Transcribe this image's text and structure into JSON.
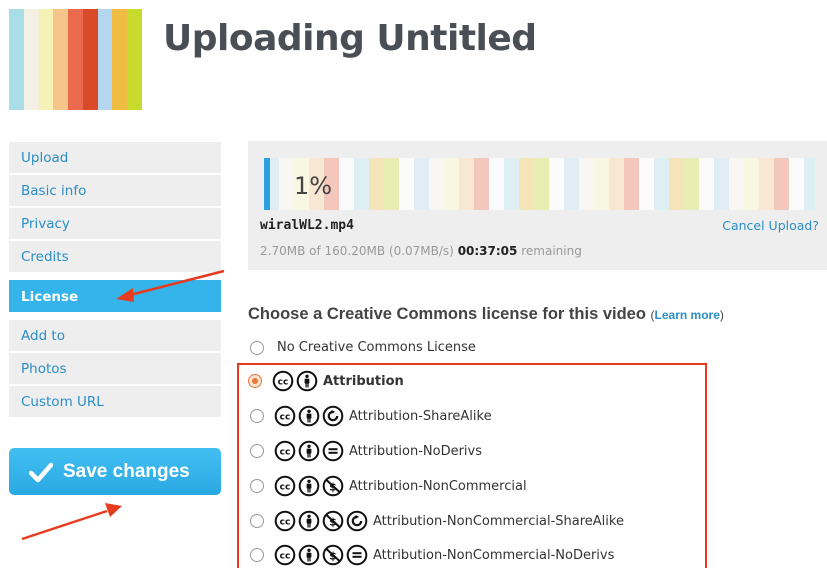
{
  "header": {
    "title": "Uploading Untitled",
    "logo_colors": [
      "#a9dde8",
      "#f4f0e4",
      "#f6f2b6",
      "#f7c58a",
      "#e96a4f",
      "#d94a2b",
      "#b5d6ee",
      "#efbd43",
      "#c9da2f"
    ]
  },
  "sidebar": {
    "items": [
      {
        "label": "Upload"
      },
      {
        "label": "Basic info"
      },
      {
        "label": "Privacy"
      },
      {
        "label": "Credits"
      },
      {
        "label": "License",
        "active": true
      },
      {
        "label": "Add to"
      },
      {
        "label": "Photos"
      },
      {
        "label": "Custom URL"
      }
    ],
    "save_label": "Save changes"
  },
  "upload": {
    "progress_label": "1%",
    "progress_value": 0.01,
    "file_name": "wiralWL2.mp4",
    "cancel_label": "Cancel Upload?",
    "stats_prefix": "2.70MB of 160.20MB (0.07MB/s)",
    "remaining_time": "00:37:05",
    "remaining_label": "remaining"
  },
  "license": {
    "heading": "Choose a Creative Commons license for this video",
    "learn_more": "Learn more",
    "options": [
      {
        "label": "No Creative Commons License",
        "icons": [],
        "selected": false
      },
      {
        "label": "Attribution",
        "icons": [
          "cc-icon",
          "by-icon"
        ],
        "selected": true
      },
      {
        "label": "Attribution-ShareAlike",
        "icons": [
          "cc-icon",
          "by-icon",
          "sa-icon"
        ],
        "selected": false
      },
      {
        "label": "Attribution-NoDerivs",
        "icons": [
          "cc-icon",
          "by-icon",
          "nd-icon"
        ],
        "selected": false
      },
      {
        "label": "Attribution-NonCommercial",
        "icons": [
          "cc-icon",
          "by-icon",
          "nc-icon"
        ],
        "selected": false
      },
      {
        "label": "Attribution-NonCommercial-ShareAlike",
        "icons": [
          "cc-icon",
          "by-icon",
          "nc-icon",
          "sa-icon"
        ],
        "selected": false
      },
      {
        "label": "Attribution-NonCommercial-NoDerivs",
        "icons": [
          "cc-icon",
          "by-icon",
          "nc-icon",
          "nd-icon"
        ],
        "selected": false
      }
    ]
  },
  "annotations": {
    "arrow_color": "#e63b1f",
    "highlight_color": "#e63b1f"
  }
}
